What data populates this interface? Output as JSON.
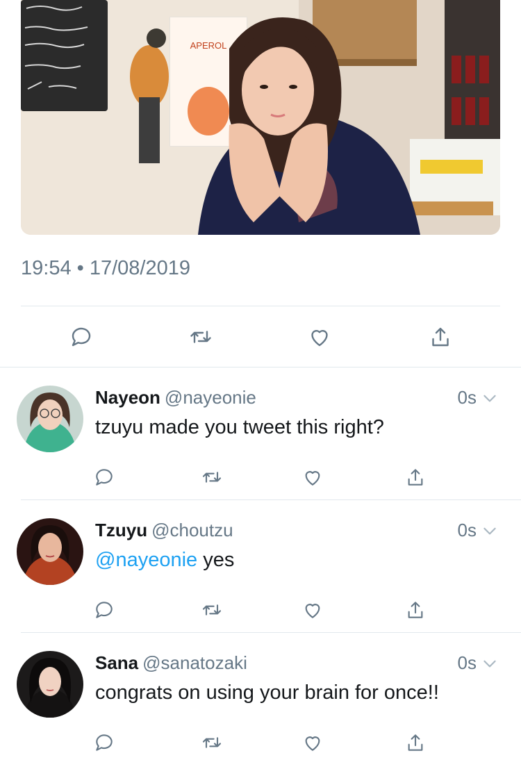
{
  "tweet": {
    "timestamp": "19:54 • 17/08/2019",
    "photo": {
      "sign_text": "APEROL\nSPRITZ",
      "chalkboard_lines": [
        "Pinot grigio",
        "ne glass",
        "Chianti dolce",
        "O grigiano",
        "1000/1 litri"
      ]
    }
  },
  "icons": {
    "reply": "reply-icon",
    "retweet": "retweet-icon",
    "like": "heart-icon",
    "share": "share-icon",
    "more": "chevron-down-icon"
  },
  "colors": {
    "mention": "#1da1f2",
    "secondary_text": "#657786",
    "divider": "#e1e8ed",
    "icon": "#657786"
  },
  "replies": [
    {
      "name": "Nayeon",
      "handle": "@nayeonie",
      "time": "0s",
      "text": "tzuyu made you tweet this right?"
    },
    {
      "name": "Tzuyu",
      "handle": "@choutzu",
      "time": "0s",
      "mention": "@nayeonie",
      "text": " yes"
    },
    {
      "name": "Sana",
      "handle": "@sanatozaki",
      "time": "0s",
      "text": "congrats on using your brain for once!!"
    }
  ]
}
